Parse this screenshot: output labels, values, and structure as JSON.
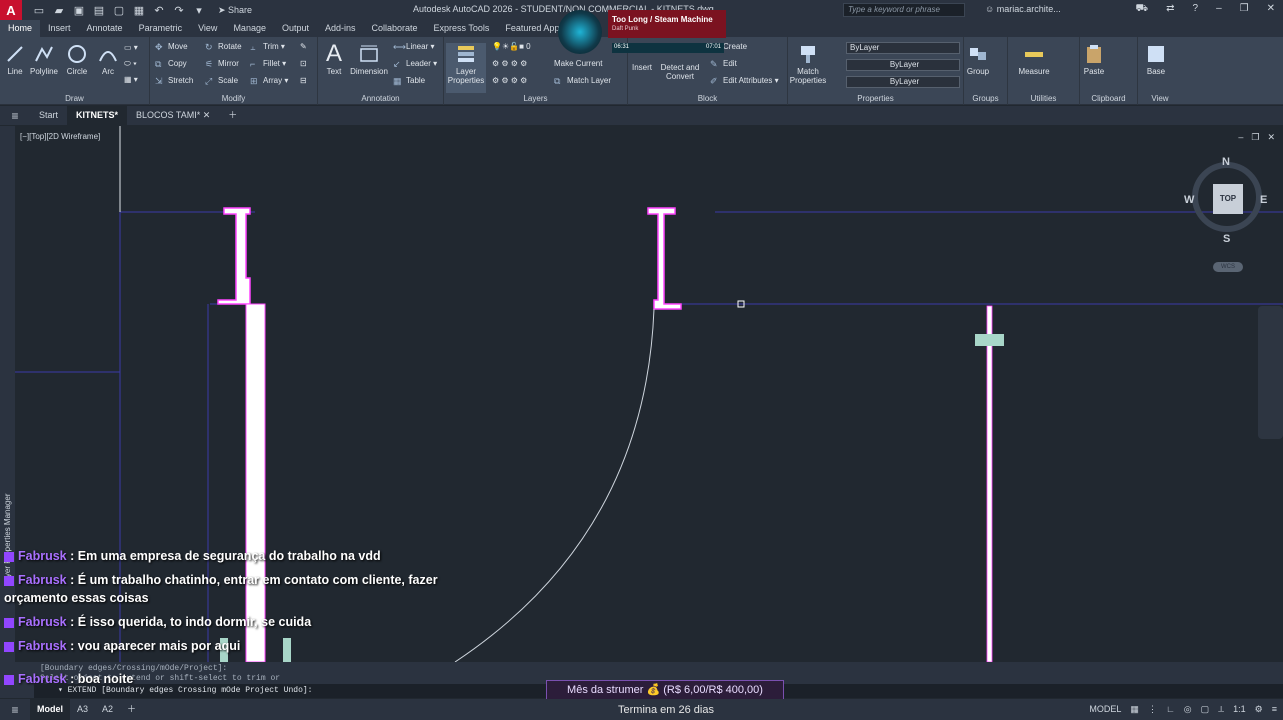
{
  "app": {
    "logo": "A",
    "title": "Autodesk AutoCAD 2026 - STUDENT/NON COMMERCIAL - KITNETS.dwg",
    "share": "Share",
    "search_placeholder": "Type a keyword or phrase",
    "user": "mariac.archite..."
  },
  "ribbon_tabs": [
    "Home",
    "Insert",
    "Annotate",
    "Parametric",
    "View",
    "Manage",
    "Output",
    "Add-ins",
    "Collaborate",
    "Express Tools",
    "Featured Apps"
  ],
  "ribbon": {
    "draw": {
      "title": "Draw",
      "line": "Line",
      "polyline": "Polyline",
      "circle": "Circle",
      "arc": "Arc"
    },
    "modify": {
      "title": "Modify",
      "move": "Move",
      "rotate": "Rotate",
      "trim": "Trim",
      "copy": "Copy",
      "mirror": "Mirror",
      "fillet": "Fillet",
      "stretch": "Stretch",
      "scale": "Scale",
      "array": "Array"
    },
    "annotation": {
      "title": "Annotation",
      "text": "Text",
      "dimension": "Dimension",
      "linear": "Linear",
      "leader": "Leader",
      "table": "Table"
    },
    "layers": {
      "title": "Layers",
      "layer_properties": "Layer Properties",
      "layer_value": "0",
      "make_current": "Make Current",
      "match_layer": "Match Layer"
    },
    "block": {
      "title": "Block",
      "insert": "Insert",
      "detect_convert": "Detect and Convert",
      "create": "Create",
      "edit": "Edit",
      "edit_attributes": "Edit Attributes"
    },
    "properties": {
      "title": "Properties",
      "match": "Match Properties",
      "color": "ByLayer",
      "linetype": "ByLayer",
      "lineweight": "ByLayer"
    },
    "groups": {
      "title": "Groups",
      "group": "Group"
    },
    "utilities": {
      "title": "Utilities",
      "measure": "Measure"
    },
    "clipboard": {
      "title": "Clipboard",
      "paste": "Paste"
    },
    "view": {
      "title": "View",
      "base": "Base"
    }
  },
  "media": {
    "song": "Too Long / Steam Machine",
    "artist": "Daft Punk",
    "elapsed": "06:31",
    "total": "07:01"
  },
  "doc_tabs": [
    "Start",
    "KITNETS*",
    "BLOCOS TAMI*"
  ],
  "viewport": {
    "label": "[−][Top][2D Wireframe]",
    "side_palette": "Layer Properties Manager",
    "viewcube": {
      "top": "TOP",
      "n": "N",
      "s": "S",
      "e": "E",
      "w": "W",
      "wcs": "WCS"
    }
  },
  "chat": [
    {
      "user": "Fabrusk",
      "text": ": Em uma empresa de segurança do trabalho na vdd"
    },
    {
      "user": "Fabrusk",
      "text": ": É um trabalho chatinho, entrar em contato com cliente, fazer orçamento essas coisas"
    },
    {
      "user": "Fabrusk",
      "text": ": É isso querida, to indo dormir, se cuida"
    },
    {
      "user": "Fabrusk",
      "text": ": vou aparecer mais por aqui"
    },
    {
      "user": "Fabrusk",
      "text": ": boa noite"
    }
  ],
  "command": {
    "history1": "[Boundary edges/Crossing/mOde/Project]:",
    "history2": "Select object to extend or shift-select to trim or",
    "current": "EXTEND [Boundary edges Crossing mOde Project Undo]:"
  },
  "sub_goal": "Mês da strumer 💰 (R$ 6,00/R$ 400,00)",
  "sub_time": "Termina em 26 dias",
  "layout_tabs": [
    "Model",
    "A3",
    "A2"
  ],
  "status": {
    "model": "MODEL",
    "scale": "1:1"
  },
  "colors": {
    "accent": "#c8102e",
    "chat_user": "#a970ff",
    "geometry": "#ffffff",
    "magenta": "#ff44ff",
    "blue_line": "#3a3aa8"
  }
}
